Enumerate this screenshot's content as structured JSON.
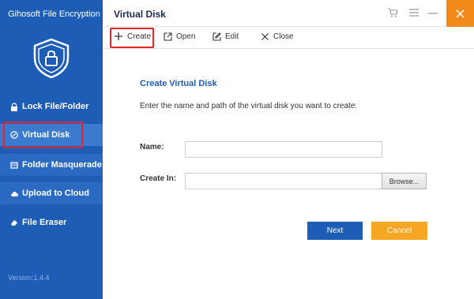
{
  "app": {
    "name": "Gihosoft File Encryption",
    "version": "Version:1.4.4"
  },
  "sidebar": {
    "items": [
      {
        "label": "Lock File/Folder",
        "icon": "lock-icon"
      },
      {
        "label": "Virtual Disk",
        "icon": "disk-icon",
        "active": true
      },
      {
        "label": "Folder Masquerade",
        "icon": "masquerade-icon"
      },
      {
        "label": "Upload to Cloud",
        "icon": "cloud-upload-icon"
      },
      {
        "label": "File Eraser",
        "icon": "eraser-icon"
      }
    ]
  },
  "window": {
    "title": "Virtual Disk"
  },
  "toolbar": {
    "create": "Create",
    "open": "Open",
    "edit": "Edit",
    "close": "Close"
  },
  "content": {
    "title": "Create Virtual Disk",
    "instructions": "Enter the name and path of the virtual disk you want to create:",
    "name_label": "Name:",
    "name_value": "",
    "create_in_label": "Create In:",
    "create_in_value": "",
    "browse_label": "Browse...",
    "next_label": "Next",
    "cancel_label": "Cancel"
  },
  "colors": {
    "sidebar": "#1e5db5",
    "accent_orange": "#f5a623",
    "highlight": "#e8232a"
  }
}
